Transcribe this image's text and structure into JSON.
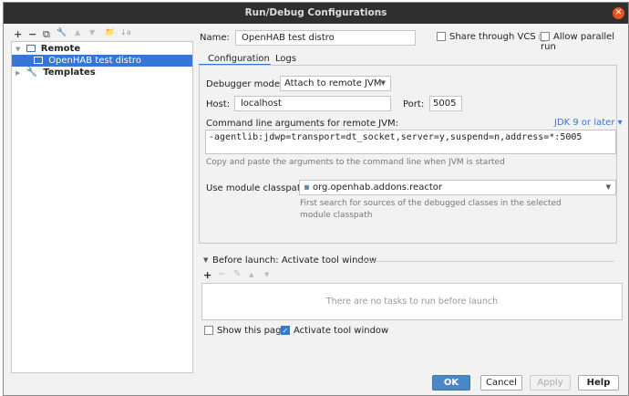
{
  "window": {
    "title": "Run/Debug Configurations",
    "close": "✕"
  },
  "toolbar": {
    "icons": [
      "+",
      "−",
      "⧉",
      "🔧",
      "▲",
      "▼",
      "📁",
      "↓a"
    ]
  },
  "tree": {
    "remote": "Remote",
    "item": "OpenHAB test distro",
    "templates": "Templates"
  },
  "name": {
    "label": "Name:",
    "value": "OpenHAB test distro"
  },
  "share": {
    "label": "Share through VCS",
    "help": "?"
  },
  "parallel": {
    "label": "Allow parallel run"
  },
  "tabs": [
    "Configuration",
    "Logs"
  ],
  "debugger": {
    "label": "Debugger mode:",
    "value": "Attach to remote JVM"
  },
  "host": {
    "label": "Host:",
    "value": "localhost"
  },
  "port": {
    "label": "Port:",
    "value": "5005"
  },
  "cmd": {
    "label": "Command line arguments for remote JVM:",
    "jdk": "JDK 9 or later",
    "value": "-agentlib:jdwp=transport=dt_socket,server=y,suspend=n,address=*:5005",
    "hint": "Copy and paste the arguments to the command line when JVM is started"
  },
  "module": {
    "label": "Use module classpath:",
    "value": "org.openhab.addons.reactor",
    "hint1": "First search for sources of the debugged classes in the selected",
    "hint2": "module classpath"
  },
  "before": {
    "title": "Before launch: Activate tool window",
    "empty": "There are no tasks to run before launch"
  },
  "show_page": "Show this page",
  "activate": "Activate tool window",
  "buttons": {
    "ok": "OK",
    "cancel": "Cancel",
    "apply": "Apply",
    "help": "Help"
  }
}
